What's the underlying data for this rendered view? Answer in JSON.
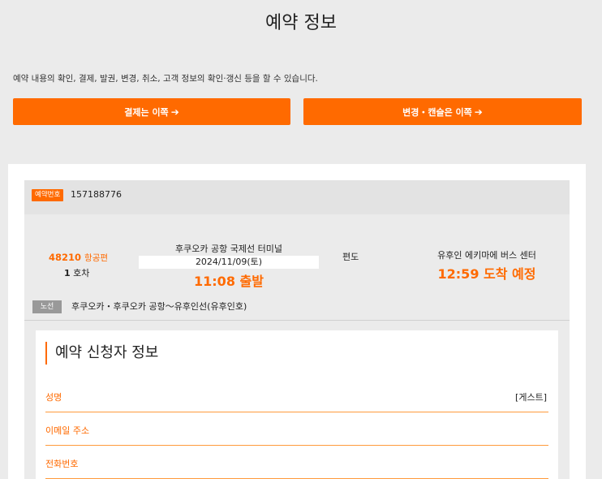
{
  "page": {
    "title": "예약 정보",
    "intro": "예약 내용의 확인, 결제, 발권, 변경, 취소, 고객 정보의 확인·갱신 등을 할 수 있습니다."
  },
  "buttons": {
    "pay": "결제는 이쪽",
    "change": "변경・캔슬은 이쪽",
    "arrow": "➔"
  },
  "reservation": {
    "number_label": "예약번호",
    "number": "157188776",
    "flight_number": "48210",
    "flight_suffix": "항공편",
    "car_number": "1",
    "car_suffix": "호차",
    "departure_terminal": "후쿠오카 공항 국제선 터미널",
    "departure_date": "2024/11/09(토)",
    "departure_time": "11:08 출발",
    "trip_type": "편도",
    "arrival_terminal": "유후인 에키마에 버스 센터",
    "arrival_time": "12:59 도착 예정",
    "route_label": "노선",
    "route": "후쿠오카・후쿠오카 공항～유후인선(유후인호)"
  },
  "applicant": {
    "section_title": "예약 신청자 정보",
    "fields": [
      {
        "label": "성명",
        "value": "[게스트]"
      },
      {
        "label": "이메일 주소",
        "value": ""
      },
      {
        "label": "전화번호",
        "value": ""
      }
    ]
  },
  "colors": {
    "accent": "#ff6a00",
    "background": "#ebebeb",
    "badge_gray": "#999999"
  }
}
